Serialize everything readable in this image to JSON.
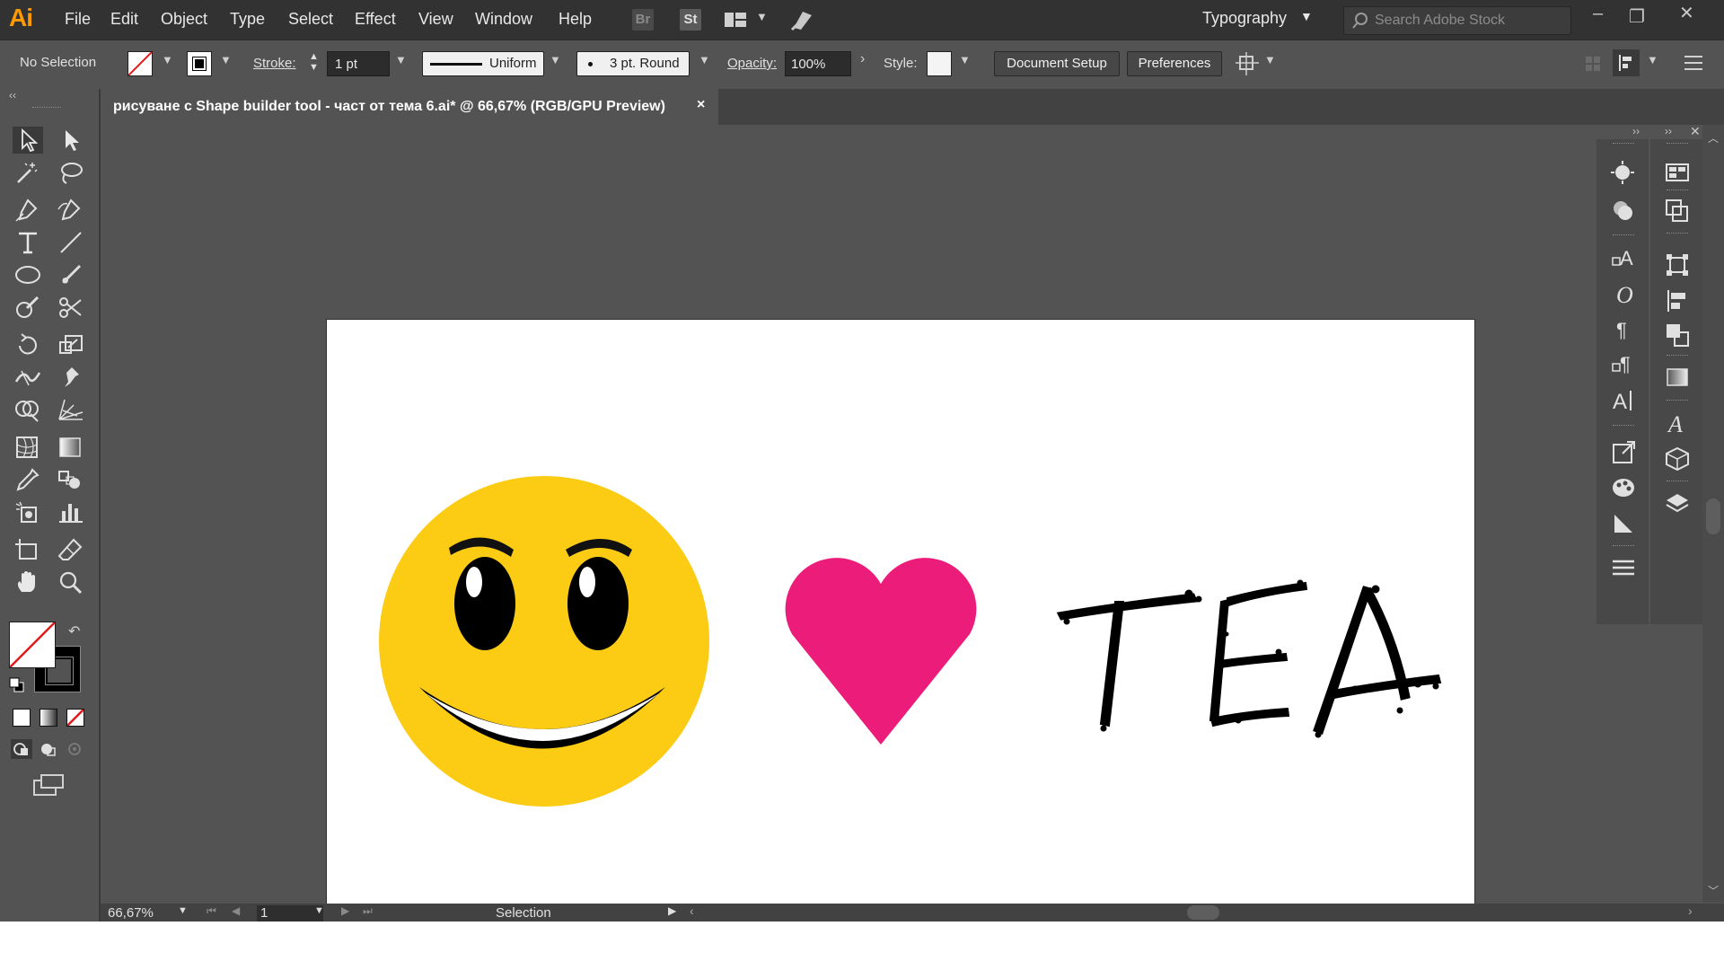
{
  "menu": {
    "app_logo": "Ai",
    "items": [
      "File",
      "Edit",
      "Object",
      "Type",
      "Select",
      "Effect",
      "View",
      "Window",
      "Help"
    ],
    "bridge_label": "Br",
    "stock_label": "St",
    "workspace": "Typography",
    "search_placeholder": "Search Adobe Stock"
  },
  "control": {
    "selection_label": "No Selection",
    "stroke_label": "Stroke:",
    "stroke_value": "1 pt",
    "profile_label": "Uniform",
    "brush_label": "3 pt. Round",
    "opacity_label": "Opacity:",
    "opacity_value": "100%",
    "style_label": "Style:",
    "doc_setup_label": "Document Setup",
    "preferences_label": "Preferences"
  },
  "document": {
    "tab_title": "рисуване с Shape builder tool - част от тема 6.ai* @ 66,67% (RGB/GPU Preview)",
    "close_glyph": "×"
  },
  "artwork": {
    "text": "TEA",
    "smiley_color": "#fccb14",
    "heart_color": "#ec1c7a",
    "text_color": "#000000"
  },
  "status": {
    "zoom": "66,67%",
    "artboard_number": "1",
    "tool_name": "Selection"
  },
  "colors": {
    "app_bg": "#535353",
    "menubar_bg": "#323232",
    "accent_ai": "#ff9a00"
  }
}
